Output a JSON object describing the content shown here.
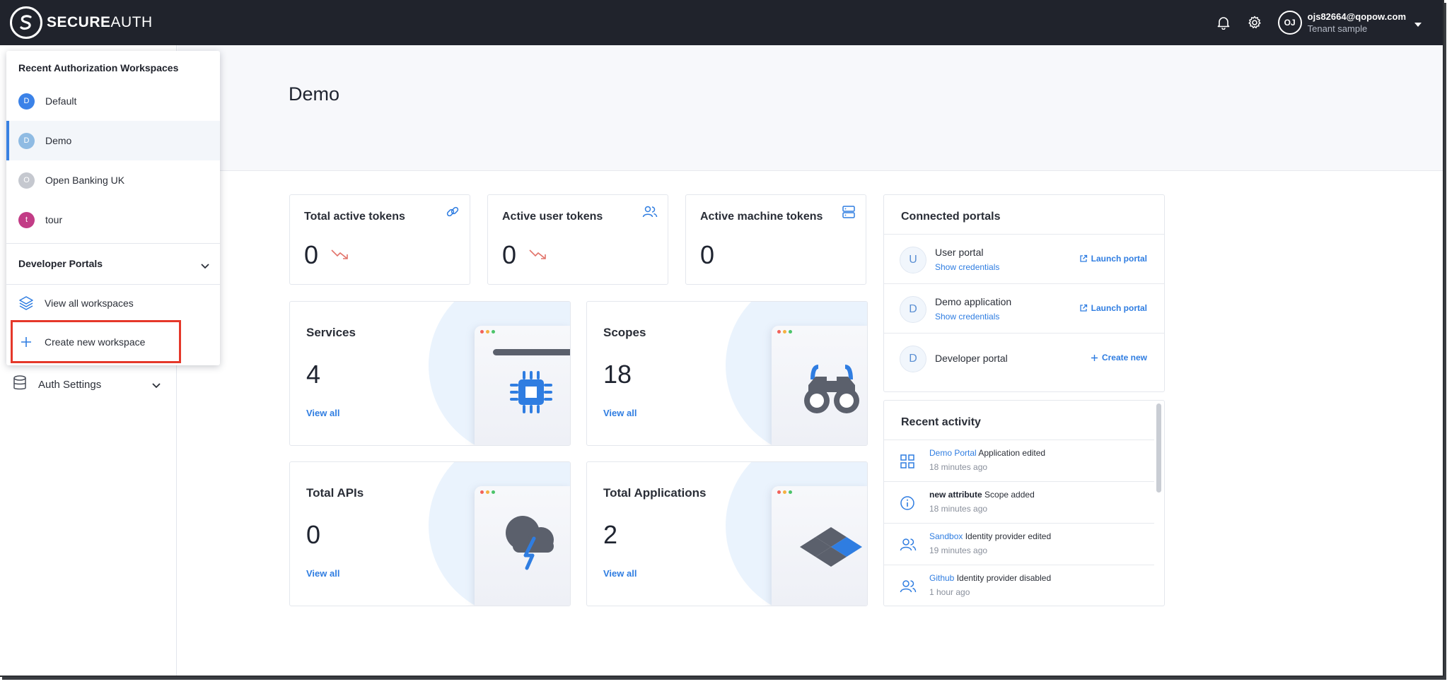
{
  "brand": {
    "name_bold": "SECURE",
    "name_rest": "AUTH"
  },
  "topbar": {
    "avatar_initials": "OJ",
    "user_email": "ojs82664@qopow.com",
    "tenant": "Tenant sample",
    "icons": [
      "bell-icon",
      "gear-icon",
      "chevron-down-icon"
    ]
  },
  "sidebar": {
    "auth_settings_label": "Auth Settings"
  },
  "dropdown": {
    "header": "Recent Authorization Workspaces",
    "workspaces": [
      {
        "initial": "D",
        "label": "Default",
        "color": "#3b82e8"
      },
      {
        "initial": "D",
        "label": "Demo",
        "color": "#8fbbe3",
        "active": true
      },
      {
        "initial": "O",
        "label": "Open Banking UK",
        "color": "#c5c8cf"
      },
      {
        "initial": "t",
        "label": "tour",
        "color": "#c23c86"
      }
    ],
    "section_label": "Developer Portals",
    "view_all_label": "View all workspaces",
    "create_label": "Create new workspace"
  },
  "page": {
    "title": "Demo"
  },
  "stats": [
    {
      "label": "Total active tokens",
      "value": "0",
      "icon": "link-icon",
      "trend": "down"
    },
    {
      "label": "Active user tokens",
      "value": "0",
      "icon": "users-icon",
      "trend": "down"
    },
    {
      "label": "Active machine tokens",
      "value": "0",
      "icon": "server-icon"
    }
  ],
  "cards": [
    {
      "label": "Services",
      "value": "4",
      "link": "View all",
      "illustration": "chip-icon"
    },
    {
      "label": "Scopes",
      "value": "18",
      "link": "View all",
      "illustration": "binoculars-icon"
    },
    {
      "label": "Total APIs",
      "value": "0",
      "link": "View all",
      "illustration": "cloud-lightning-icon"
    },
    {
      "label": "Total Applications",
      "value": "2",
      "link": "View all",
      "illustration": "layers-diamond-icon"
    }
  ],
  "portals": {
    "title": "Connected portals",
    "items": [
      {
        "initial": "U",
        "name": "User portal",
        "sub": "Show credentials",
        "action": "Launch portal"
      },
      {
        "initial": "D",
        "name": "Demo application",
        "sub": "Show credentials",
        "action": "Launch portal"
      },
      {
        "initial": "D",
        "name": "Developer portal",
        "action": "Create new"
      }
    ]
  },
  "activity": {
    "title": "Recent activity",
    "items": [
      {
        "icon": "grid-icon",
        "entity": "Demo Portal",
        "event": "Application edited",
        "time": "18 minutes ago"
      },
      {
        "icon": "info-icon",
        "entity": "new attribute",
        "event": "Scope added",
        "time": "18 minutes ago"
      },
      {
        "icon": "users-icon",
        "entity": "Sandbox",
        "event": "Identity provider edited",
        "time": "19 minutes ago"
      },
      {
        "icon": "users-icon",
        "entity": "Github",
        "event": "Identity provider disabled",
        "time": "1 hour ago"
      }
    ]
  }
}
